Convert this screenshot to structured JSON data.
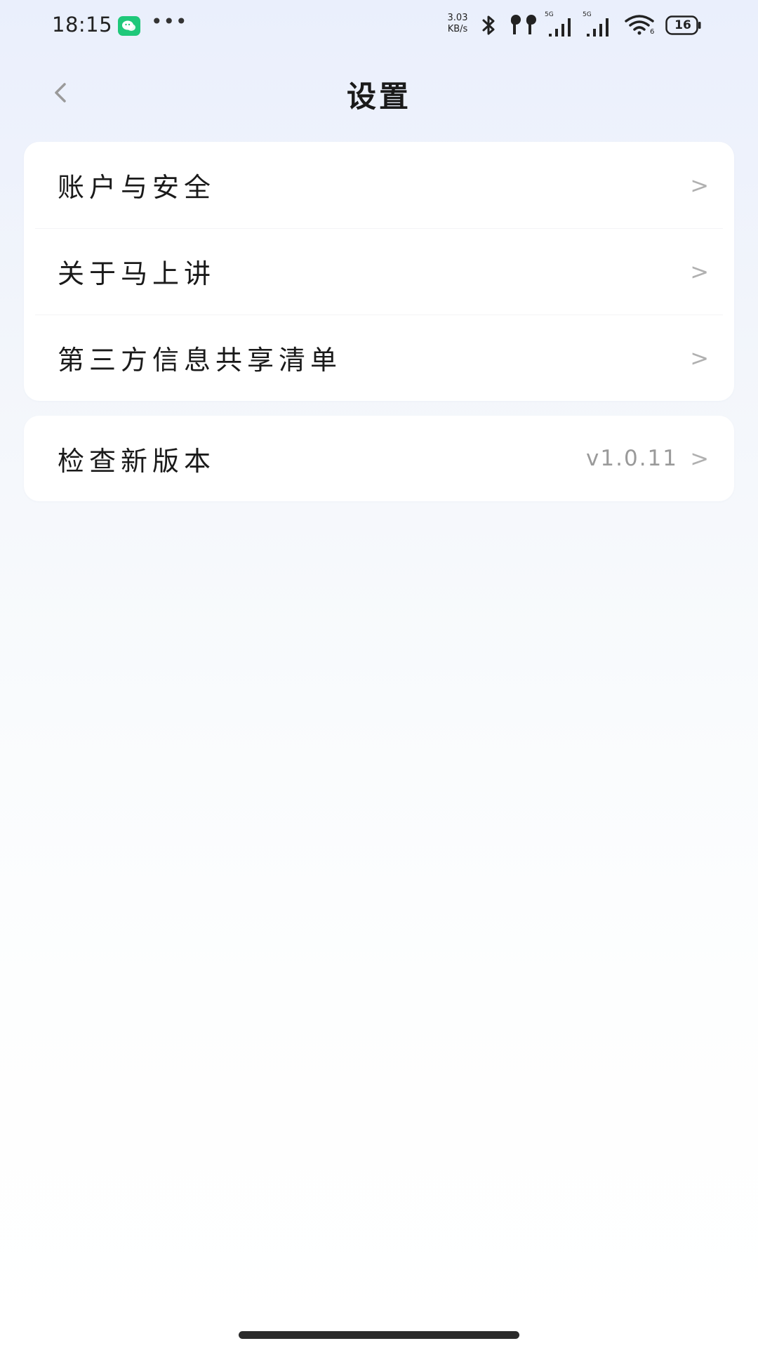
{
  "status_bar": {
    "time": "18:15",
    "more": "•••",
    "net_speed_value": "3.03",
    "net_speed_unit": "KB/s",
    "signal_1_tag": "5G",
    "signal_2_tag": "5G",
    "wifi_tag": "6",
    "battery": "16",
    "icons": [
      "chat-app-icon",
      "bluetooth-icon",
      "earbuds-icon",
      "signal-icon",
      "signal-icon",
      "wifi-icon",
      "battery-icon"
    ]
  },
  "nav": {
    "title": "设置",
    "back_icon": "chevron-left-icon"
  },
  "groups": [
    {
      "items": [
        {
          "label": "账户与安全",
          "chevron": ">"
        },
        {
          "label": "关于马上讲",
          "chevron": ">"
        },
        {
          "label": "第三方信息共享清单",
          "chevron": ">"
        }
      ]
    },
    {
      "items": [
        {
          "label": "检查新版本",
          "value": "v1.0.11",
          "chevron": ">"
        }
      ]
    }
  ],
  "colors": {
    "accent_green": "#1fc87a",
    "text_primary": "#1a1a1a",
    "text_secondary": "#9a9a9a"
  }
}
